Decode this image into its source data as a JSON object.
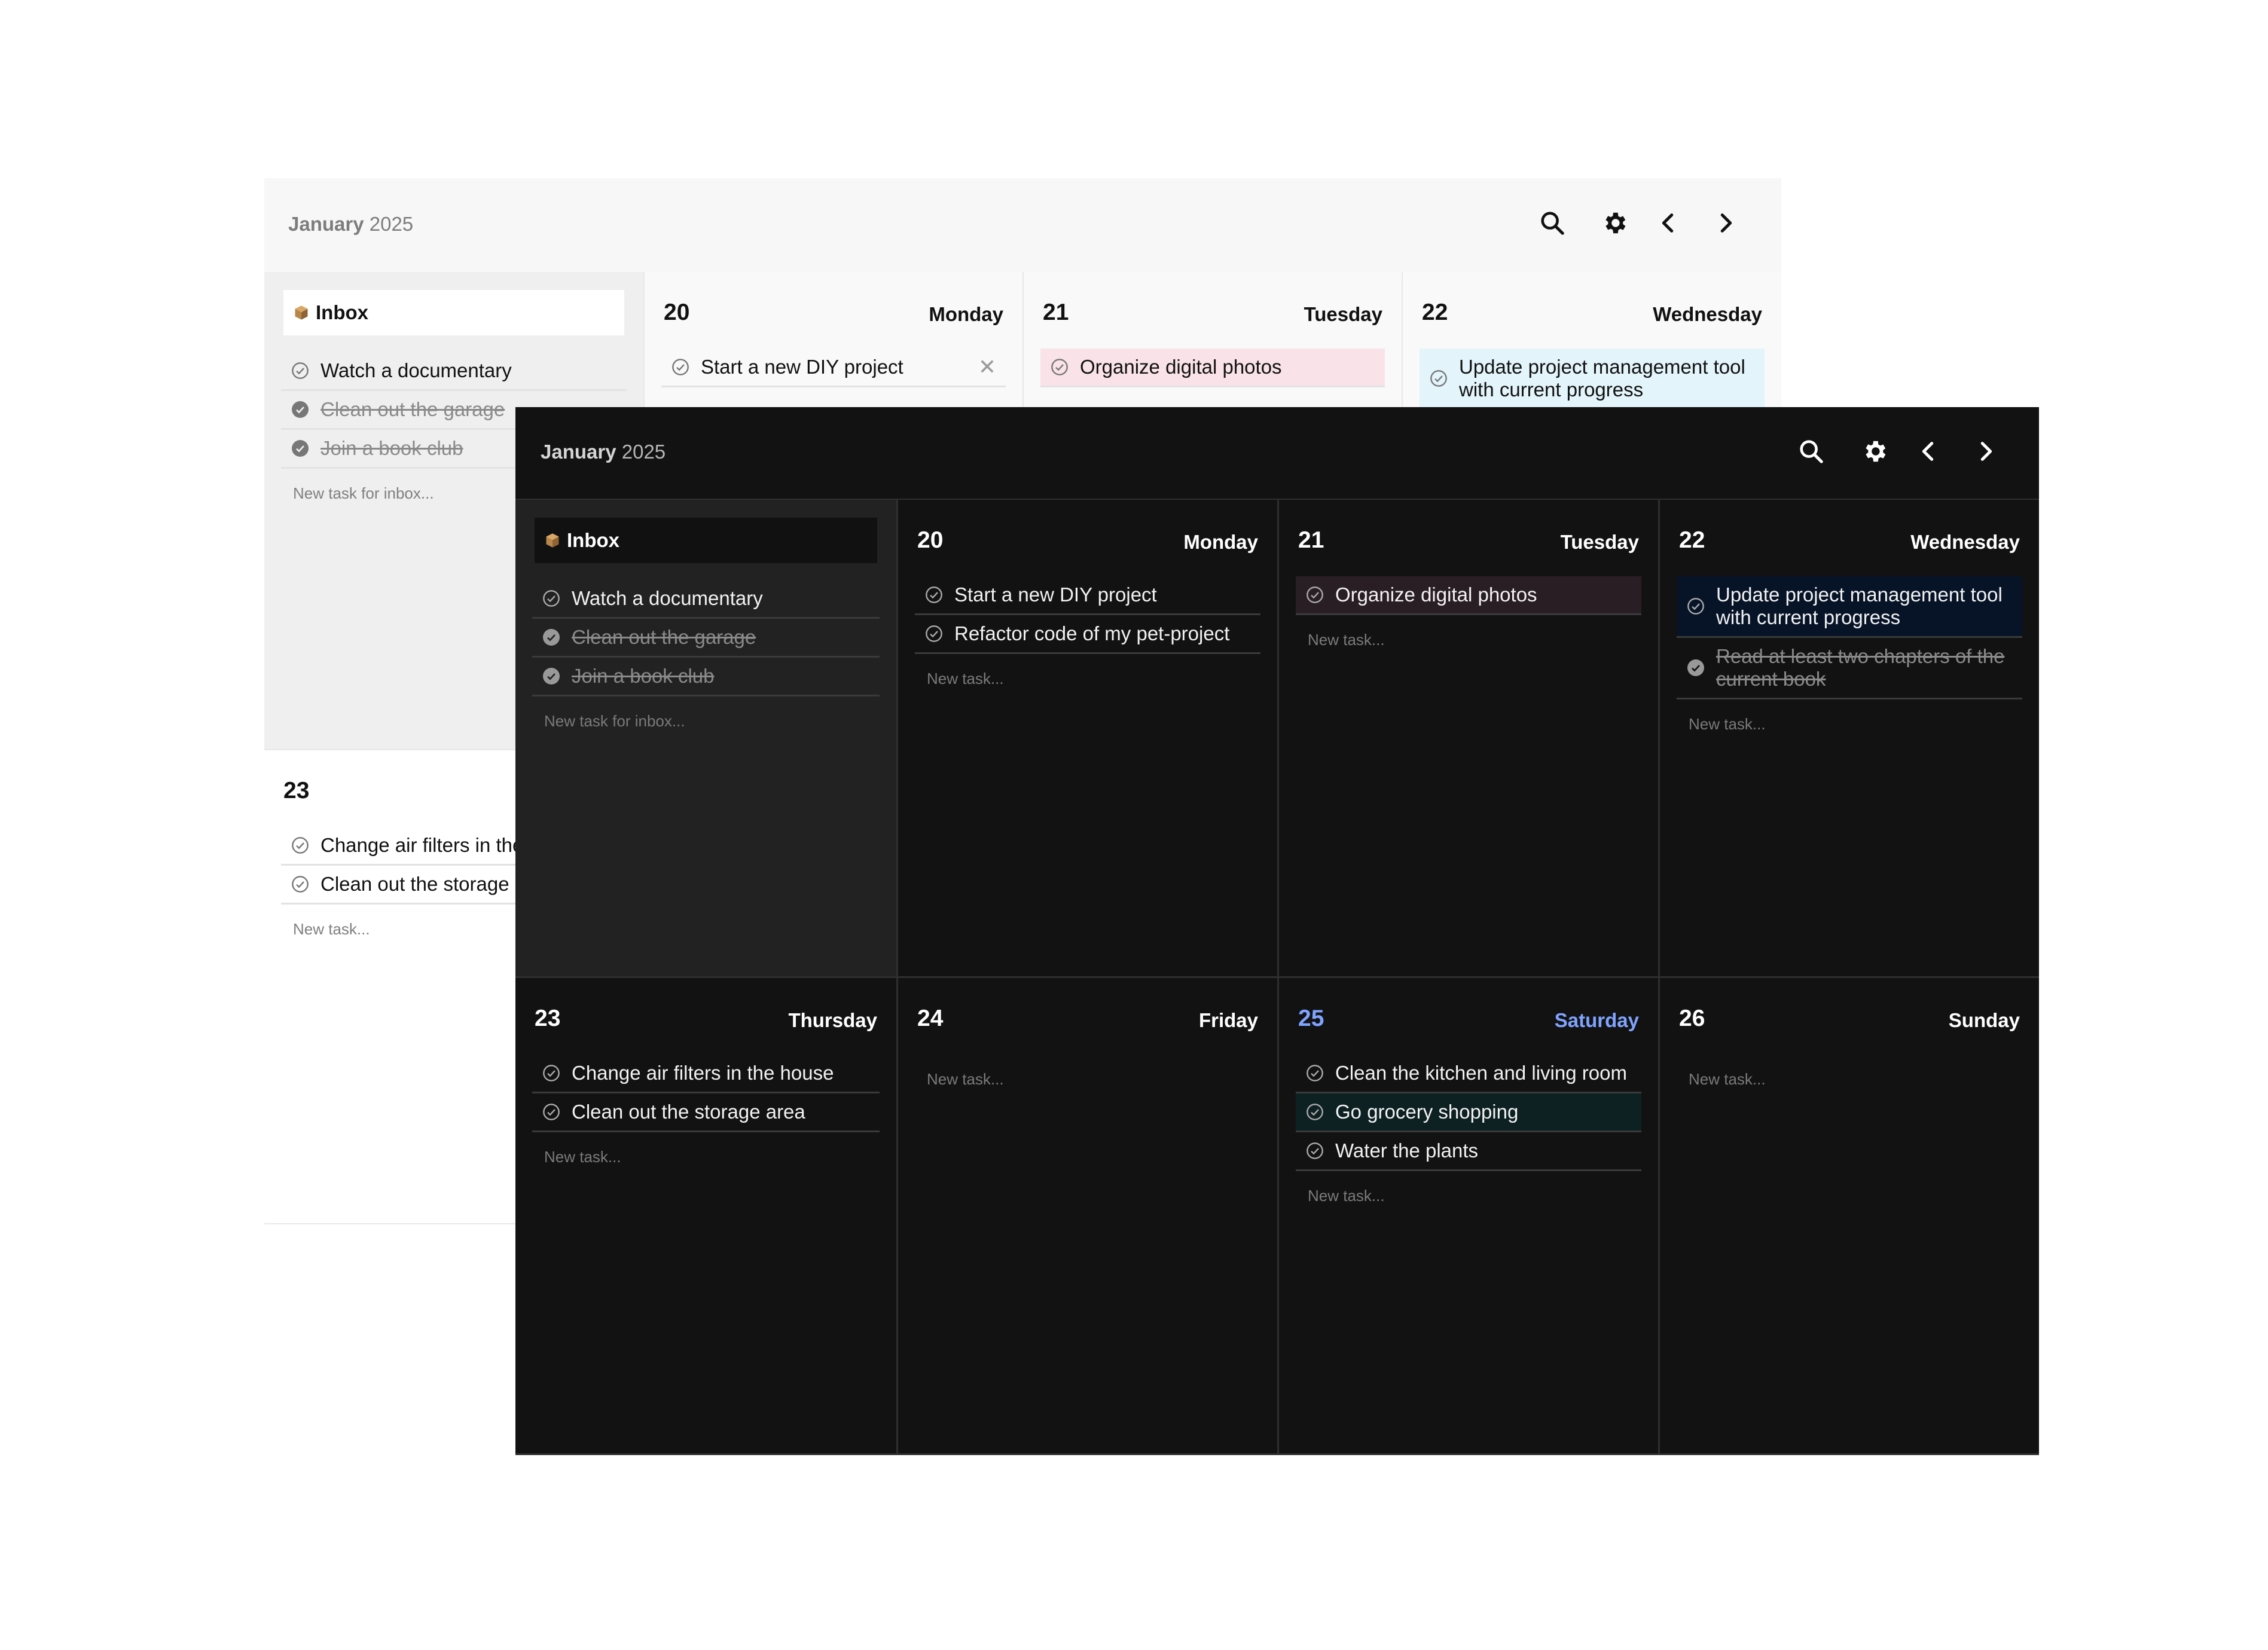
{
  "light_window": {
    "month": "January",
    "year": "2025",
    "inbox": {
      "title": "Inbox",
      "tasks": [
        {
          "text": "Watch a documentary",
          "done": false
        },
        {
          "text": "Clean out the garage",
          "done": true
        },
        {
          "text": "Join a book club",
          "done": true
        }
      ],
      "new_placeholder": "New task for inbox..."
    },
    "days": [
      {
        "num": "20",
        "name": "Monday",
        "tasks": [
          {
            "text": "Start a new DIY project",
            "delete": "✕"
          }
        ]
      },
      {
        "num": "21",
        "name": "Tuesday",
        "tasks": [
          {
            "text": "Organize digital photos"
          }
        ]
      },
      {
        "num": "22",
        "name": "Wednesday",
        "tasks": [
          {
            "text": "Update project management tool with current progress"
          }
        ]
      },
      {
        "num": "23",
        "tasks": [
          {
            "text": "Change air filters in the house"
          },
          {
            "text": "Clean out the storage area"
          }
        ],
        "new_placeholder": "New task..."
      }
    ]
  },
  "dark_window": {
    "month": "January",
    "year": "2025",
    "inbox": {
      "title": "Inbox",
      "tasks": [
        {
          "text": "Watch a documentary",
          "done": false
        },
        {
          "text": "Clean out the garage",
          "done": true
        },
        {
          "text": "Join a book club",
          "done": true
        }
      ],
      "new_placeholder": "New task for inbox..."
    },
    "days": [
      {
        "num": "20",
        "name": "Monday",
        "tasks": [
          {
            "text": "Start a new DIY project"
          },
          {
            "text": "Refactor code of my pet-project"
          }
        ],
        "new_placeholder": "New task..."
      },
      {
        "num": "21",
        "name": "Tuesday",
        "tasks": [
          {
            "text": "Organize digital photos"
          }
        ],
        "new_placeholder": "New task..."
      },
      {
        "num": "22",
        "name": "Wednesday",
        "tasks": [
          {
            "text": "Update project management tool with current progress"
          },
          {
            "text": "Read at least two chapters of the current book",
            "done": true
          }
        ],
        "new_placeholder": "New task..."
      },
      {
        "num": "23",
        "name": "Thursday",
        "tasks": [
          {
            "text": "Change air filters in the house"
          },
          {
            "text": "Clean out the storage area"
          }
        ],
        "new_placeholder": "New task..."
      },
      {
        "num": "24",
        "name": "Friday",
        "tasks": [],
        "new_placeholder": "New task..."
      },
      {
        "num": "25",
        "name": "Saturday",
        "today": true,
        "tasks": [
          {
            "text": "Clean the kitchen and living room"
          },
          {
            "text": "Go grocery shopping"
          },
          {
            "text": "Water the plants"
          }
        ],
        "new_placeholder": "New task..."
      },
      {
        "num": "26",
        "name": "Sunday",
        "tasks": [],
        "new_placeholder": "New task..."
      }
    ]
  },
  "icons": [
    "search-icon",
    "gear-icon",
    "chevron-left-icon",
    "chevron-right-icon",
    "box-icon",
    "check-circle-icon"
  ],
  "colors": {
    "today_accent": "#7fa4ff",
    "pink_task_light": "#f9e2e8",
    "blue_task_light": "#e3f4fb",
    "dark_bg": "#121212"
  }
}
